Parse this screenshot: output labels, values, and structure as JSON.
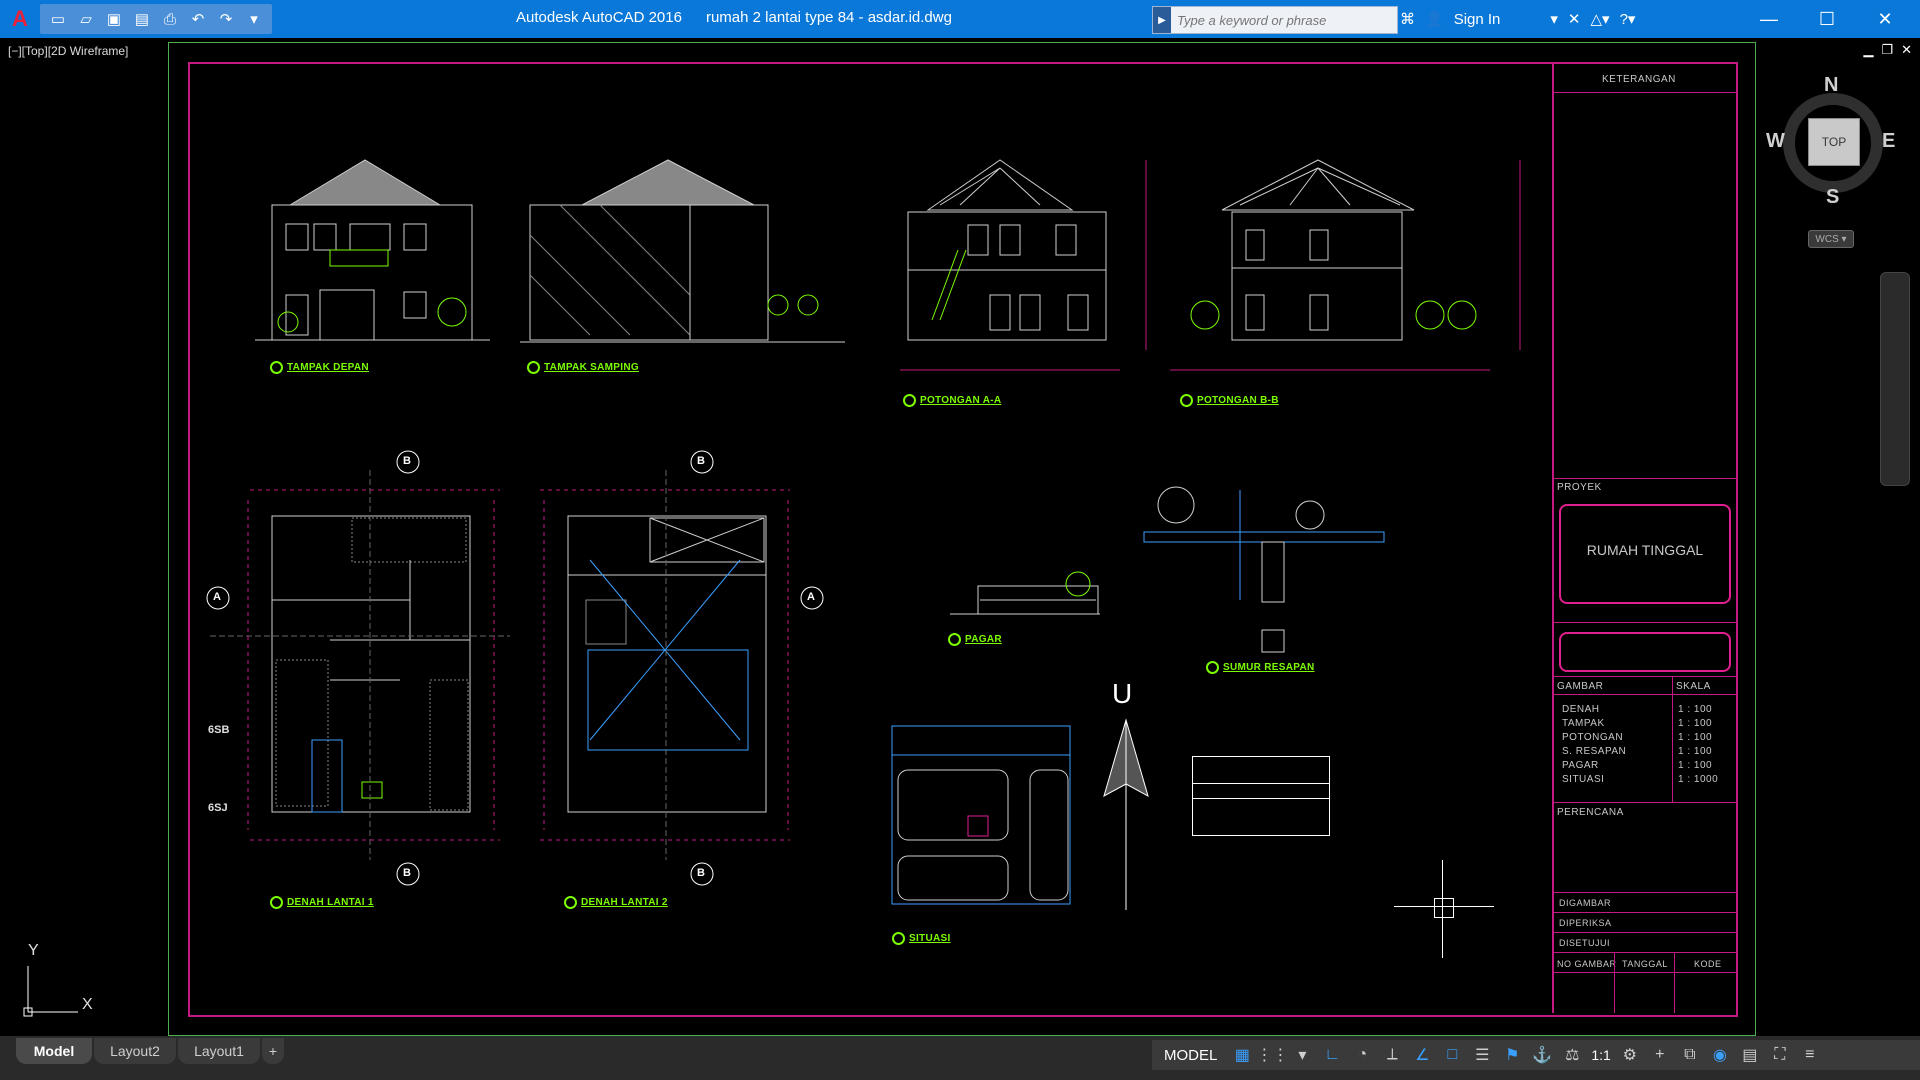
{
  "titlebar": {
    "app_title": "Autodesk AutoCAD 2016",
    "file_name": "rumah 2 lantai type 84 - asdar.id.dwg",
    "search_placeholder": "Type a keyword or phrase",
    "sign_in": "Sign In"
  },
  "viewport": {
    "label": "[−][Top][2D Wireframe]"
  },
  "viewcube": {
    "face": "TOP",
    "north": "N",
    "south": "S",
    "east": "E",
    "west": "W",
    "wcs": "WCS"
  },
  "drawing": {
    "elevations": [
      "TAMPAK DEPAN",
      "TAMPAK SAMPING"
    ],
    "sections": [
      "POTONGAN A-A",
      "POTONGAN B-B"
    ],
    "plans": [
      "DENAH LANTAI 1",
      "DENAH LANTAI 2"
    ],
    "details": [
      "PAGAR",
      "SUMUR RESAPAN",
      "SITUASI"
    ],
    "north_label": "U",
    "grid_labels": [
      "6SB",
      "6SJ"
    ],
    "section_marks": [
      "A",
      "B"
    ]
  },
  "titleblock": {
    "keterangan": "KETERANGAN",
    "proyek_label": "PROYEK",
    "project_name": "RUMAH TINGGAL",
    "gambar_label": "GAMBAR",
    "skala_label": "SKALA",
    "schedule": [
      {
        "name": "DENAH",
        "scale": "1 : 100"
      },
      {
        "name": "TAMPAK",
        "scale": "1 : 100"
      },
      {
        "name": "POTONGAN",
        "scale": "1 : 100"
      },
      {
        "name": "S. RESAPAN",
        "scale": "1 : 100"
      },
      {
        "name": "PAGAR",
        "scale": "1 : 100"
      },
      {
        "name": "SITUASI",
        "scale": "1 : 1000"
      }
    ],
    "perencana_label": "PERENCANA",
    "digambar": "DIGAMBAR",
    "diperiksa": "DIPERIKSA",
    "disetujui": "DISETUJUI",
    "no_gambar": "NO GAMBAR",
    "tanggal": "TANGGAL",
    "kode": "KODE"
  },
  "ucs": {
    "x": "X",
    "y": "Y"
  },
  "tabs": [
    "Model",
    "Layout2",
    "Layout1"
  ],
  "statusbar": {
    "model": "MODEL",
    "scale": "1:1"
  },
  "colors": {
    "titlebar": "#0a78d8",
    "border": "#c21a80",
    "label": "#7cfc00",
    "sheet_edge": "#4caf50"
  }
}
